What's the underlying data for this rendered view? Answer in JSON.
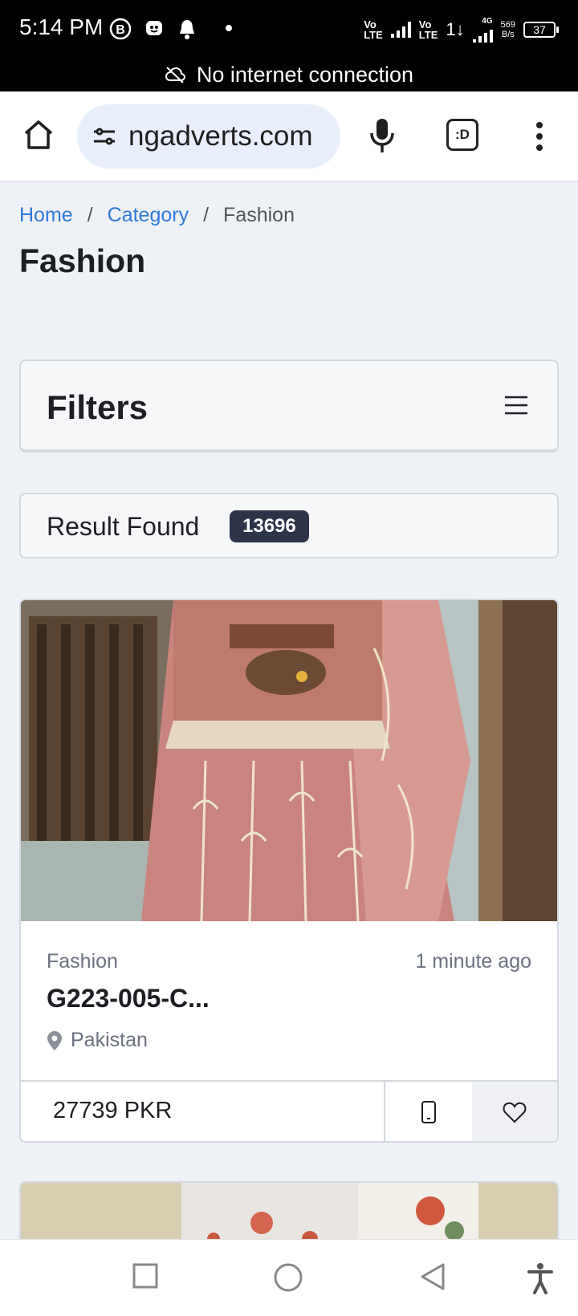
{
  "status_bar": {
    "time": "5:14 PM",
    "volte1": [
      "Vo",
      "LTE"
    ],
    "volte2": [
      "Vo",
      "LTE"
    ],
    "network_type": "4G",
    "net_speed": [
      "569",
      "B/s"
    ],
    "battery": "37"
  },
  "offline_banner": "No internet connection",
  "browser": {
    "url": "ngadverts.com",
    "extension_label": ":D"
  },
  "breadcrumb": {
    "home": "Home",
    "category": "Category",
    "separator": "/",
    "current": "Fashion"
  },
  "page_title": "Fashion",
  "filters_label": "Filters",
  "results": {
    "label": "Result Found",
    "count": "13696"
  },
  "listing": {
    "category": "Fashion",
    "posted": "1 minute ago",
    "title": "G223-005-C...",
    "location": "Pakistan",
    "price": "27739 PKR"
  }
}
